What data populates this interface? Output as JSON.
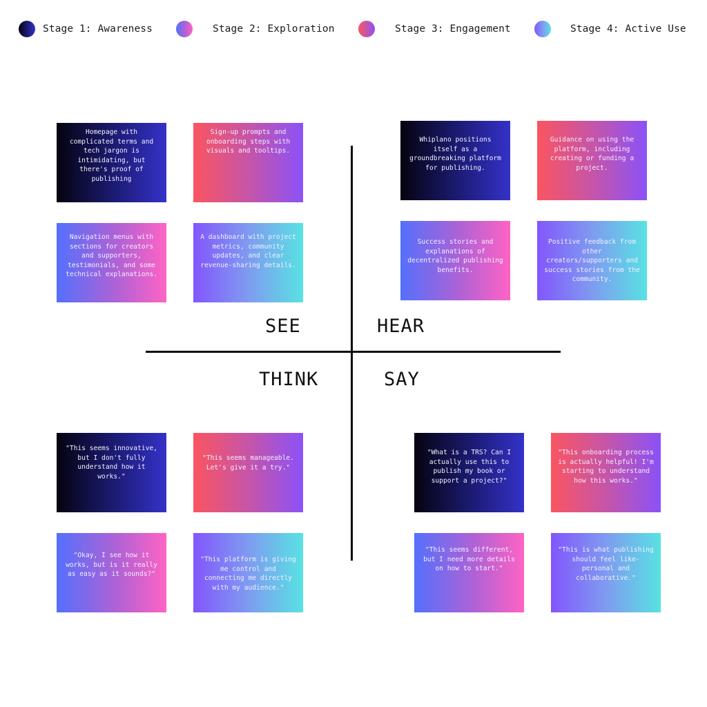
{
  "legend": [
    {
      "label": "Stage 1: Awareness",
      "gradient": [
        "#05030f",
        "#3432c8"
      ]
    },
    {
      "label": "Stage 2: Exploration",
      "gradient": [
        "#5470fc",
        "#fe63c4"
      ]
    },
    {
      "label": "Stage 3: Engagement",
      "gradient": [
        "#fa5560",
        "#8b52f7"
      ]
    },
    {
      "label": "Stage 4: Active Use",
      "gradient": [
        "#8256fc",
        "#58e2e3"
      ]
    }
  ],
  "quadrants": {
    "see": {
      "label": "SEE",
      "cards": [
        {
          "stage": 1,
          "text": "Homepage with complicated terms and tech jargon is intimidating, but there's proof of publishing"
        },
        {
          "stage": 3,
          "text": "Sign-up prompts and onboarding steps with visuals and tooltips."
        },
        {
          "stage": 2,
          "text": "Navigation menus with sections for creators and supporters, testimonials, and some technical explanations."
        },
        {
          "stage": 4,
          "text": "A dashboard with project metrics, community updates, and clear revenue-sharing details."
        }
      ]
    },
    "hear": {
      "label": "HEAR",
      "cards": [
        {
          "stage": 1,
          "text": "Whiplano positions itself as a groundbreaking platform for publishing."
        },
        {
          "stage": 3,
          "text": "Guidance on using the platform, including creating or funding a project."
        },
        {
          "stage": 2,
          "text": "Success stories and explanations of decentralized publishing benefits."
        },
        {
          "stage": 4,
          "text": "Positive feedback from other creators/supporters and success stories from the community."
        }
      ]
    },
    "think": {
      "label": "THINK",
      "cards": [
        {
          "stage": 1,
          "text": "\"This seems innovative, but I don't fully understand how it works.\""
        },
        {
          "stage": 3,
          "text": "\"This seems manageable. Let's give it a try.\""
        },
        {
          "stage": 2,
          "text": "\"Okay, I see how it works, but is it really as easy as it sounds?\""
        },
        {
          "stage": 4,
          "text": "\"This platform is giving me control and connecting me directly with my audience.\""
        }
      ]
    },
    "say": {
      "label": "SAY",
      "cards": [
        {
          "stage": 1,
          "text": "\"What is a TRS? Can I actually use this to publish my book or support a project?\""
        },
        {
          "stage": 3,
          "text": "\"This onboarding process is actually helpful! I'm starting to understand how this works.\""
        },
        {
          "stage": 2,
          "text": "\"This seems different, but I need more details on how to start.\""
        },
        {
          "stage": 4,
          "text": "\"This is what publishing should feel like-personal and collaborative.\""
        }
      ]
    }
  }
}
